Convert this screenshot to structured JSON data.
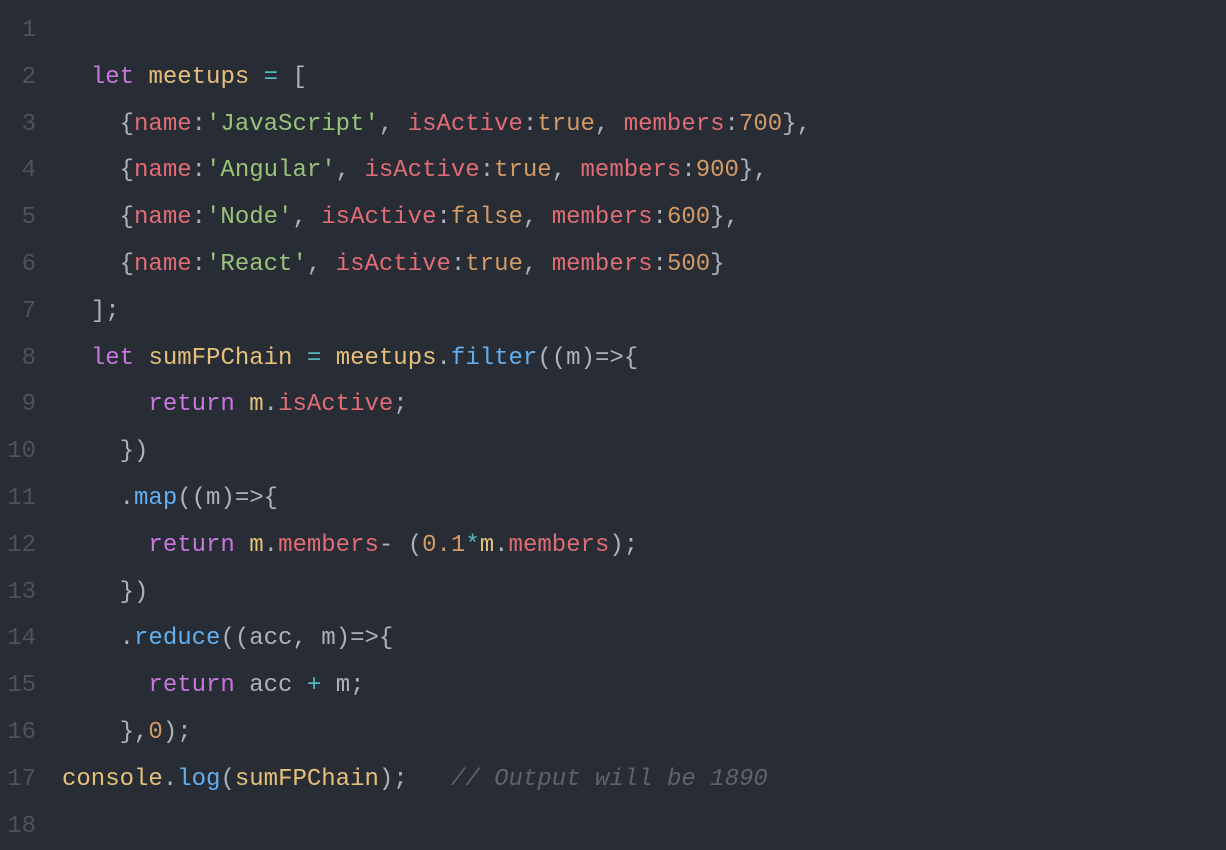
{
  "lines": {
    "1": {
      "num": "1"
    },
    "2": {
      "num": "2",
      "indent": "  ",
      "let": "let",
      "var": "meetups",
      "eq": " = ",
      "open": "["
    },
    "3": {
      "num": "3",
      "indent": "    ",
      "ob": "{",
      "k1": "name",
      "c1": ":",
      "v1": "'JavaScript'",
      "s1": ", ",
      "k2": "isActive",
      "c2": ":",
      "v2": "true",
      "s2": ", ",
      "k3": "members",
      "c3": ":",
      "v3": "700",
      "cb": "},",
      "trail": ""
    },
    "4": {
      "num": "4",
      "indent": "    ",
      "ob": "{",
      "k1": "name",
      "c1": ":",
      "v1": "'Angular'",
      "s1": ", ",
      "k2": "isActive",
      "c2": ":",
      "v2": "true",
      "s2": ", ",
      "k3": "members",
      "c3": ":",
      "v3": "900",
      "cb": "},",
      "trail": ""
    },
    "5": {
      "num": "5",
      "indent": "    ",
      "ob": "{",
      "k1": "name",
      "c1": ":",
      "v1": "'Node'",
      "s1": ", ",
      "k2": "isActive",
      "c2": ":",
      "v2": "false",
      "s2": ", ",
      "k3": "members",
      "c3": ":",
      "v3": "600",
      "cb": "},",
      "trail": ""
    },
    "6": {
      "num": "6",
      "indent": "    ",
      "ob": "{",
      "k1": "name",
      "c1": ":",
      "v1": "'React'",
      "s1": ", ",
      "k2": "isActive",
      "c2": ":",
      "v2": "true",
      "s2": ", ",
      "k3": "members",
      "c3": ":",
      "v3": "500",
      "cb": "}",
      "trail": ""
    },
    "7": {
      "num": "7",
      "indent": "  ",
      "close": "];"
    },
    "8": {
      "num": "8",
      "indent": "  ",
      "let": "let",
      "var": "sumFPChain",
      "eq": " = ",
      "obj": "meetups",
      "dot": ".",
      "fn": "filter",
      "args_open": "((",
      "param": "m",
      "arrow": ")=>{",
      "tail": ""
    },
    "9": {
      "num": "9",
      "indent": "      ",
      "ret": "return",
      "sp": " ",
      "obj": "m",
      "dot": ".",
      "prop": "isActive",
      "semi": ";"
    },
    "10": {
      "num": "10",
      "indent": "    ",
      "close": "})"
    },
    "11": {
      "num": "11",
      "indent": "    ",
      "dot": ".",
      "fn": "map",
      "args_open": "((",
      "param": "m",
      "arrow": ")=>{"
    },
    "12": {
      "num": "12",
      "indent": "      ",
      "ret": "return",
      "sp": " ",
      "o1": "m",
      "d1": ".",
      "p1": "members",
      "mid": "- (",
      "n1": "0.1",
      "star": "*",
      "o2": "m",
      "d2": ".",
      "p2": "members",
      "end": ");"
    },
    "13": {
      "num": "13",
      "indent": "    ",
      "close": "})"
    },
    "14": {
      "num": "14",
      "indent": "    ",
      "dot": ".",
      "fn": "reduce",
      "args_open": "((",
      "p1": "acc",
      "comma": ", ",
      "p2": "m",
      "arrow": ")=>{"
    },
    "15": {
      "num": "15",
      "indent": "      ",
      "ret": "return",
      "sp": " ",
      "a": "acc",
      "plus": " + ",
      "b": "m",
      "semi": ";"
    },
    "16": {
      "num": "16",
      "indent": "    ",
      "close": "},",
      "zero": "0",
      "end": ");"
    },
    "17": {
      "num": "17",
      "indent": "",
      "obj": "console",
      "dot": ".",
      "fn": "log",
      "open": "(",
      "arg": "sumFPChain",
      "close": ");",
      "gap": "   ",
      "comment": "// Output will be 1890"
    },
    "18": {
      "num": "18"
    }
  }
}
